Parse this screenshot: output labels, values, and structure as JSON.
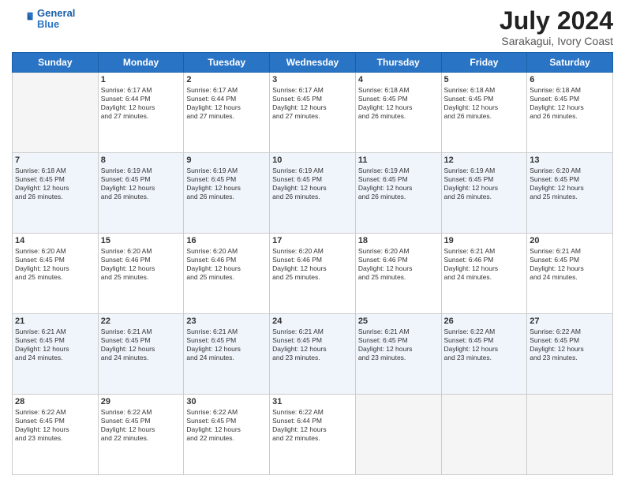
{
  "header": {
    "logo_line1": "General",
    "logo_line2": "Blue",
    "month": "July 2024",
    "location": "Sarakagui, Ivory Coast"
  },
  "weekdays": [
    "Sunday",
    "Monday",
    "Tuesday",
    "Wednesday",
    "Thursday",
    "Friday",
    "Saturday"
  ],
  "weeks": [
    [
      {
        "day": "",
        "info": ""
      },
      {
        "day": "1",
        "info": "Sunrise: 6:17 AM\nSunset: 6:44 PM\nDaylight: 12 hours\nand 27 minutes."
      },
      {
        "day": "2",
        "info": "Sunrise: 6:17 AM\nSunset: 6:44 PM\nDaylight: 12 hours\nand 27 minutes."
      },
      {
        "day": "3",
        "info": "Sunrise: 6:17 AM\nSunset: 6:45 PM\nDaylight: 12 hours\nand 27 minutes."
      },
      {
        "day": "4",
        "info": "Sunrise: 6:18 AM\nSunset: 6:45 PM\nDaylight: 12 hours\nand 26 minutes."
      },
      {
        "day": "5",
        "info": "Sunrise: 6:18 AM\nSunset: 6:45 PM\nDaylight: 12 hours\nand 26 minutes."
      },
      {
        "day": "6",
        "info": "Sunrise: 6:18 AM\nSunset: 6:45 PM\nDaylight: 12 hours\nand 26 minutes."
      }
    ],
    [
      {
        "day": "7",
        "info": "Sunrise: 6:18 AM\nSunset: 6:45 PM\nDaylight: 12 hours\nand 26 minutes."
      },
      {
        "day": "8",
        "info": "Sunrise: 6:19 AM\nSunset: 6:45 PM\nDaylight: 12 hours\nand 26 minutes."
      },
      {
        "day": "9",
        "info": "Sunrise: 6:19 AM\nSunset: 6:45 PM\nDaylight: 12 hours\nand 26 minutes."
      },
      {
        "day": "10",
        "info": "Sunrise: 6:19 AM\nSunset: 6:45 PM\nDaylight: 12 hours\nand 26 minutes."
      },
      {
        "day": "11",
        "info": "Sunrise: 6:19 AM\nSunset: 6:45 PM\nDaylight: 12 hours\nand 26 minutes."
      },
      {
        "day": "12",
        "info": "Sunrise: 6:19 AM\nSunset: 6:45 PM\nDaylight: 12 hours\nand 26 minutes."
      },
      {
        "day": "13",
        "info": "Sunrise: 6:20 AM\nSunset: 6:45 PM\nDaylight: 12 hours\nand 25 minutes."
      }
    ],
    [
      {
        "day": "14",
        "info": "Sunrise: 6:20 AM\nSunset: 6:45 PM\nDaylight: 12 hours\nand 25 minutes."
      },
      {
        "day": "15",
        "info": "Sunrise: 6:20 AM\nSunset: 6:46 PM\nDaylight: 12 hours\nand 25 minutes."
      },
      {
        "day": "16",
        "info": "Sunrise: 6:20 AM\nSunset: 6:46 PM\nDaylight: 12 hours\nand 25 minutes."
      },
      {
        "day": "17",
        "info": "Sunrise: 6:20 AM\nSunset: 6:46 PM\nDaylight: 12 hours\nand 25 minutes."
      },
      {
        "day": "18",
        "info": "Sunrise: 6:20 AM\nSunset: 6:46 PM\nDaylight: 12 hours\nand 25 minutes."
      },
      {
        "day": "19",
        "info": "Sunrise: 6:21 AM\nSunset: 6:46 PM\nDaylight: 12 hours\nand 24 minutes."
      },
      {
        "day": "20",
        "info": "Sunrise: 6:21 AM\nSunset: 6:45 PM\nDaylight: 12 hours\nand 24 minutes."
      }
    ],
    [
      {
        "day": "21",
        "info": "Sunrise: 6:21 AM\nSunset: 6:45 PM\nDaylight: 12 hours\nand 24 minutes."
      },
      {
        "day": "22",
        "info": "Sunrise: 6:21 AM\nSunset: 6:45 PM\nDaylight: 12 hours\nand 24 minutes."
      },
      {
        "day": "23",
        "info": "Sunrise: 6:21 AM\nSunset: 6:45 PM\nDaylight: 12 hours\nand 24 minutes."
      },
      {
        "day": "24",
        "info": "Sunrise: 6:21 AM\nSunset: 6:45 PM\nDaylight: 12 hours\nand 23 minutes."
      },
      {
        "day": "25",
        "info": "Sunrise: 6:21 AM\nSunset: 6:45 PM\nDaylight: 12 hours\nand 23 minutes."
      },
      {
        "day": "26",
        "info": "Sunrise: 6:22 AM\nSunset: 6:45 PM\nDaylight: 12 hours\nand 23 minutes."
      },
      {
        "day": "27",
        "info": "Sunrise: 6:22 AM\nSunset: 6:45 PM\nDaylight: 12 hours\nand 23 minutes."
      }
    ],
    [
      {
        "day": "28",
        "info": "Sunrise: 6:22 AM\nSunset: 6:45 PM\nDaylight: 12 hours\nand 23 minutes."
      },
      {
        "day": "29",
        "info": "Sunrise: 6:22 AM\nSunset: 6:45 PM\nDaylight: 12 hours\nand 22 minutes."
      },
      {
        "day": "30",
        "info": "Sunrise: 6:22 AM\nSunset: 6:45 PM\nDaylight: 12 hours\nand 22 minutes."
      },
      {
        "day": "31",
        "info": "Sunrise: 6:22 AM\nSunset: 6:44 PM\nDaylight: 12 hours\nand 22 minutes."
      },
      {
        "day": "",
        "info": ""
      },
      {
        "day": "",
        "info": ""
      },
      {
        "day": "",
        "info": ""
      }
    ]
  ]
}
